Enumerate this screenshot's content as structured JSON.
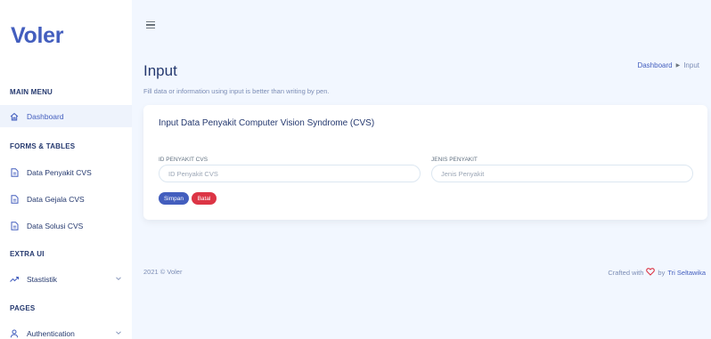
{
  "app": {
    "logo": "Voler"
  },
  "sidebar": {
    "sections": [
      {
        "title": "MAIN MENU"
      },
      {
        "title": "FORMS & TABLES"
      },
      {
        "title": "EXTRA UI"
      },
      {
        "title": "PAGES"
      }
    ],
    "items": [
      {
        "label": "Dashboard",
        "icon": "home-icon"
      },
      {
        "label": "Data Penyakit CVS",
        "icon": "file-icon"
      },
      {
        "label": "Data Gejala CVS",
        "icon": "file-icon"
      },
      {
        "label": "Data Solusi CVS",
        "icon": "file-icon"
      },
      {
        "label": "Stastistik",
        "icon": "trending-up-icon"
      },
      {
        "label": "Authentication",
        "icon": "user-icon"
      }
    ]
  },
  "header": {
    "menu_icon": "hamburger-icon"
  },
  "page": {
    "title": "Input",
    "subtitle": "Fill data or information using input is better than writing by pen.",
    "breadcrumb": {
      "home": "Dashboard",
      "current": "Input"
    }
  },
  "card": {
    "title": "Input Data Penyakit Computer Vision Syndrome (CVS)",
    "fields": [
      {
        "label": "ID PENYAKIT CVS",
        "placeholder": "ID Penyakit CVS",
        "value": ""
      },
      {
        "label": "JENIS PENYAKIT",
        "placeholder": "Jenis Penyakit",
        "value": ""
      }
    ],
    "buttons": {
      "save": "Simpan",
      "cancel": "Batal"
    }
  },
  "footer": {
    "copyright": "2021 © Voler",
    "crafted_prefix": "Crafted with",
    "crafted_by": "by",
    "author": "Tri Seltawika"
  },
  "colors": {
    "primary": "#435ebe",
    "danger": "#dc3545",
    "background": "#f2f7ff"
  }
}
